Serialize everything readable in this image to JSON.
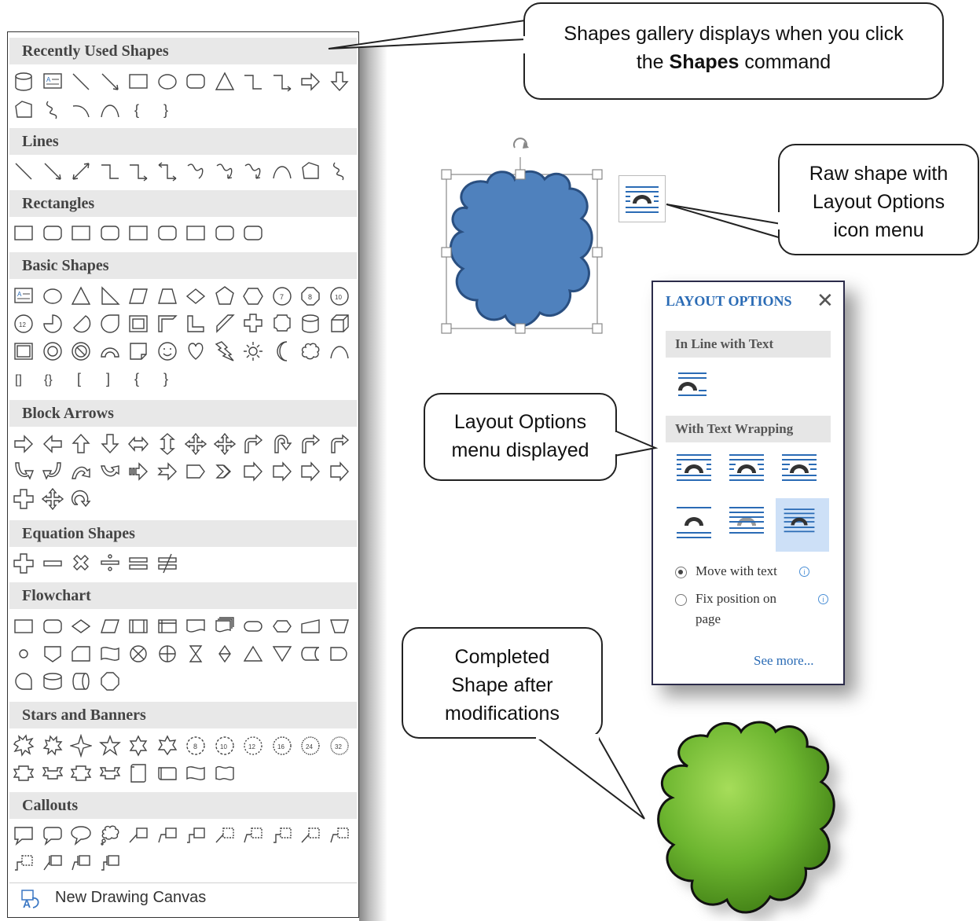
{
  "gallery": {
    "sections": [
      {
        "label": "Recently Used Shapes"
      },
      {
        "label": "Lines"
      },
      {
        "label": "Rectangles"
      },
      {
        "label": "Basic Shapes"
      },
      {
        "label": "Block Arrows"
      },
      {
        "label": "Equation Shapes"
      },
      {
        "label": "Flowchart"
      },
      {
        "label": "Stars and Banners"
      },
      {
        "label": "Callouts"
      }
    ],
    "footer_label": "New Drawing Canvas",
    "footer_icon": "drawing-canvas-icon"
  },
  "callouts": {
    "shapes_gallery": {
      "line1": "Shapes gallery displays when you click",
      "line2_pre": "the ",
      "line2_bold": "Shapes",
      "line2_post": " command"
    },
    "raw_shape": {
      "line1": "Raw shape with",
      "line2": "Layout Options",
      "line3": "icon menu"
    },
    "layout_menu": {
      "line1": "Layout Options",
      "line2": "menu displayed"
    },
    "completed": {
      "line1": "Completed",
      "line2": "Shape after",
      "line3": "modifications"
    }
  },
  "layout_options": {
    "title": "LAYOUT OPTIONS",
    "close_glyph": "✕",
    "inline_label": "In Line with Text",
    "wrapping_label": "With Text Wrapping",
    "move_with_text": "Move with text",
    "fix_position_line1": "Fix position on",
    "fix_position_line2": "page",
    "info_glyph": "i",
    "see_more": "See more...",
    "selected_wrap_index": 5
  },
  "colors": {
    "cloud_raw": "#4f81bd",
    "cloud_raw_stroke": "#2a4f80",
    "cloud_done": "#5fa530",
    "accent_blue": "#2a6bb5",
    "selected_bg": "#cde0f7"
  }
}
